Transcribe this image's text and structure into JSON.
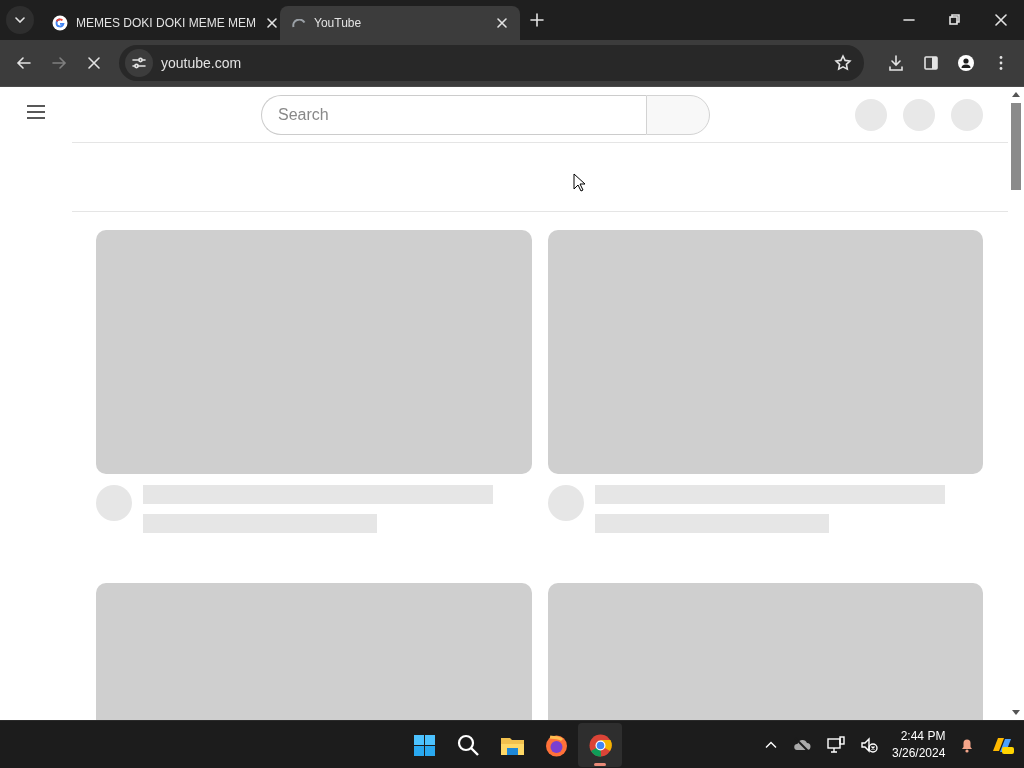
{
  "browser": {
    "tabs": [
      {
        "title": "MEMES DOKI DOKI MEME MEM",
        "selected": false,
        "loading": false
      },
      {
        "title": "YouTube",
        "selected": true,
        "loading": true
      }
    ],
    "address": "youtube.com",
    "loading": true
  },
  "page": {
    "search": {
      "placeholder": "Search"
    }
  },
  "taskbar": {
    "apps": [
      {
        "kind": "start",
        "selected": false
      },
      {
        "kind": "search",
        "selected": false
      },
      {
        "kind": "files",
        "selected": false
      },
      {
        "kind": "firefox",
        "selected": false
      },
      {
        "kind": "chrome",
        "selected": true
      }
    ],
    "time": "2:44 PM",
    "date": "3/26/2024"
  }
}
